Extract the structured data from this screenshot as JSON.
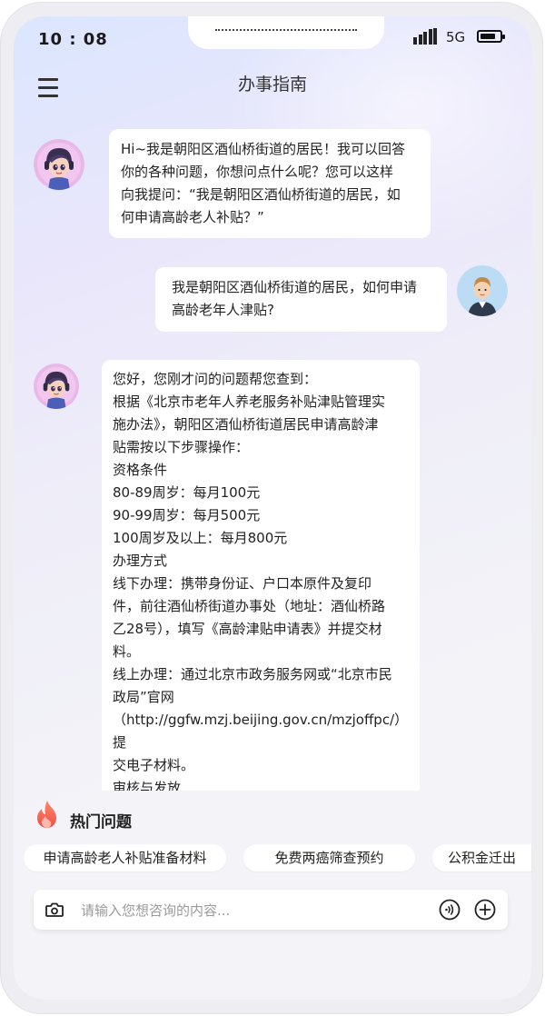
{
  "status_bar": {
    "time": "10 : 08",
    "network": "5G",
    "battery_level": 0.8
  },
  "header": {
    "title": "办事指南"
  },
  "messages": [
    {
      "role": "bot",
      "text": "Hi~我是朝阳区酒仙桥街道的居民！我可以回答\n你的各种问题，你想问点什么呢？您可以这样\n向我提问：“我是朝阳区酒仙桥街道的居民，如\n何申请高龄老人补贴？”"
    },
    {
      "role": "user",
      "text": "我是朝阳区酒仙桥街道的居民，如何申请\n高龄老年人津贴?"
    },
    {
      "role": "bot",
      "text": "您好，您刚才问的问题帮您查到：\n根据《北京市老年人养老服务补贴津贴管理实\n施办法》，朝阳区酒仙桥街道居民申请高龄津\n贴需按以下步骤操作：\n资格条件\n80-89周岁：每月100元\n90-99周岁：每月500元\n100周岁及以上：每月800元\n办理方式\n线下办理：携带身份证、户口本原件及复印\n件，前往酒仙桥街道办事处（地址：酒仙桥路\n乙28号），填写《高龄津贴申请表》并提交材\n料。\n线上办理：通过北京市政务服务网或“北京市民\n政局”官网\n（http://ggfw.mzj.beijing.gov.cn/mzjoffpc/）提\n交电子材料。\n审核与发放\n街道办事处初审后，由区民政局复核，审核通"
    }
  ],
  "hot_questions": {
    "title": "热门问题",
    "icon": "flame-icon",
    "items": [
      "申请高龄老人补贴准备材料",
      "免费两癌筛查预约",
      "公积金迁出"
    ]
  },
  "input": {
    "placeholder": "请输入您想咨询的内容...",
    "value": ""
  },
  "colors": {
    "accent_flame": "#f2584c",
    "bubble": "#ffffff",
    "background_top": "#dbe6ff"
  }
}
